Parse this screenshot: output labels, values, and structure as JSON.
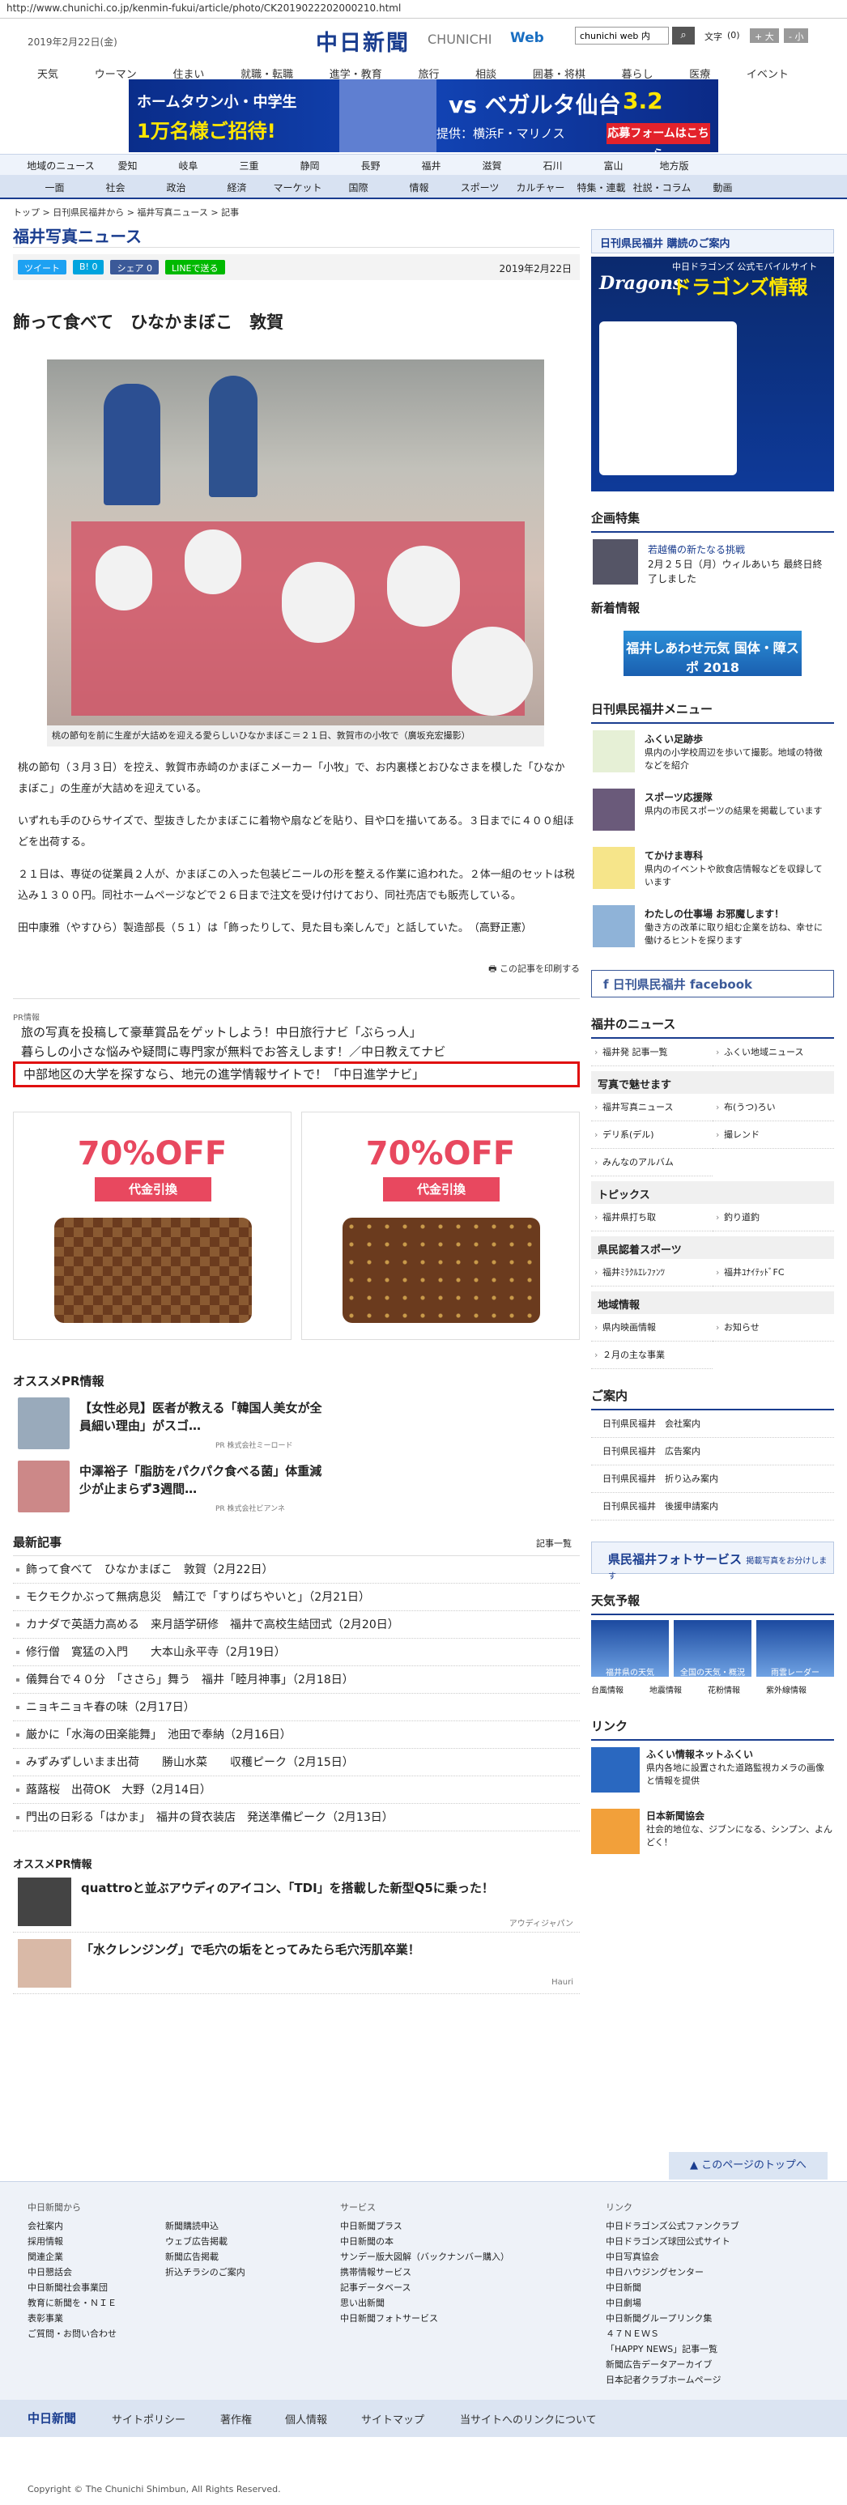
{
  "url": "http://www.chunichi.co.jp/kenmin-fukui/article/photo/CK2019022202000210.html",
  "header": {
    "date": "2019年2月22日(金)",
    "logo": "中日新聞",
    "logo_sub": "CHUNICHI",
    "logo_web": "Web",
    "search_value": "chunichi web 内",
    "text_size_label": "文字",
    "text_size_value": "(0)",
    "size_up": "+ 大",
    "size_down": "- 小"
  },
  "gnav": [
    "天気",
    "ウーマン",
    "住まい",
    "就職・転職",
    "進学・教育",
    "旅行",
    "相談",
    "囲碁・将棋",
    "暮らし",
    "医療",
    "イベント"
  ],
  "banner": {
    "line1": "ホームタウン小・中学生",
    "line2": "1万名様ご招待!",
    "vs": "vs ベガルタ仙台",
    "date": "3.2",
    "sub": "提供：横浜F・マリノス",
    "cta": "応募フォームはこちら"
  },
  "region_nav": [
    "地域のニュース",
    "愛知",
    "岐阜",
    "三重",
    "静岡",
    "長野",
    "福井",
    "滋賀",
    "石川",
    "富山",
    "地方版"
  ],
  "cat_nav": [
    "一面",
    "社会",
    "政治",
    "経済",
    "マーケット",
    "国際",
    "情報",
    "スポーツ",
    "カルチャー",
    "特集・連載",
    "社説・コラム",
    "動画"
  ],
  "breadcrumb": "トップ > 日刊県民福井から > 福井写真ニュース > 記事",
  "section_title": "福井写真ニュース",
  "share": {
    "tweet": "ツイート",
    "hatena": "B! 0",
    "facebook": "シェア 0",
    "line": "LINEで送る",
    "date": "2019年2月22日"
  },
  "headline": "飾って食べて　ひなかまぼこ　敦賀",
  "caption": "桃の節句を前に生産が大詰めを迎える愛らしいひなかまぼこ＝２１日、敦賀市の小牧で（廣坂充宏撮影）",
  "body": [
    "桃の節句（３月３日）を控え、敦賀市赤崎のかまぼこメーカー「小牧」で、お内裏様とおひなさまを模した「ひなかまぼこ」の生産が大詰めを迎えている。",
    "いずれも手のひらサイズで、型抜きしたかまぼこに着物や扇などを貼り、目や口を描いてある。３日までに４００組ほどを出荷する。",
    "２１日は、専従の従業員２人が、かまぼこの入った包装ビニールの形を整える作業に追われた。２体一組のセットは税込み１３００円。同社ホームページなどで２６日まで注文を受け付けており、同社売店でも販売している。",
    "田中康雅（やすひら）製造部長（５１）は「飾ったりして、見た目も楽しんで」と話していた。　（高野正憲）"
  ],
  "print_label": "この記事を印刷する",
  "pr": {
    "label": "PR情報",
    "items": [
      "旅の写真を投稿して豪華賞品をゲットしよう！中日旅行ナビ「ぶらっ人」",
      "暮らしの小さな悩みや疑問に専門家が無料でお答えします！／中日教えてナビ",
      "中部地区の大学を探すなら、地元の進学情報サイトで！「中日進学ナビ」"
    ]
  },
  "ads": [
    {
      "off": "70%OFF",
      "sub": "代金引換"
    },
    {
      "off": "70%OFF",
      "sub": "代金引換"
    }
  ],
  "osusume": {
    "title": "オススメPR情報",
    "items": [
      {
        "t": "【女性必見】医者が教える「韓国人美女が全員細い理由」がスゴ…",
        "pr": "PR 株式会社ミーロード"
      },
      {
        "t": "中澤裕子「脂肪をパクパク食べる菌」体重減少が止まらず3週間…",
        "pr": "PR 株式会社ビアンネ"
      }
    ]
  },
  "latest": {
    "title": "最新記事",
    "more": "記事一覧",
    "items": [
      "飾って食べて　ひなかまぼこ　敦賀（2月22日）",
      "モクモクかぶって無病息災　鯖江で「すりばちやいと」（2月21日）",
      "カナダで英語力高める　来月語学研修　福井で高校生結団式（2月20日）",
      "修行僧　寛猛の入門　　大本山永平寺（2月19日）",
      "儀舞台で４０分　「ささら」舞う　福井「睦月神事」（2月18日）",
      "ニョキニョキ春の味（2月17日）",
      "厳かに「水海の田楽能舞」　池田で奉納（2月16日）",
      "みずみずしいまま出荷　　勝山水菜　　収穫ピーク（2月15日）",
      "蕗蕗桜　出荷OK　大野（2月14日）",
      "門出の日彩る「はかま」　福井の貸衣装店　発送準備ピーク（2月13日）"
    ]
  },
  "osusume2": {
    "title": "オススメPR情報",
    "items": [
      {
        "t": "quattroと並ぶアウディのアイコン、「TDI」を搭載した新型Q5に乗った！",
        "pr": "アウディジャパン"
      },
      {
        "t": "「水クレンジング」で毛穴の垢をとってみたら毛穴汚肌卒業！",
        "pr": "Hauri"
      }
    ]
  },
  "side": {
    "subscribe": "日刊県民福井 購読のご案内",
    "dragons_logo": "Dragons",
    "dragons_title": "ドラゴンズ情報",
    "dragons_sub": "中日ドラゴンズ 公式モバイルサイト",
    "kikaku": {
      "title": "企画特集",
      "t1": "若越備の新たなる挑戦",
      "t2": "2月２５日（月）ウィルあいち 最終日終了しました"
    },
    "shinchaku": "新着情報",
    "fukui_btn": "福井しあわせ元気 国体・障スポ 2018",
    "menu_title": "日刊県民福井メニュー",
    "menu": [
      {
        "t1": "ふくい足跡歩",
        "t2": "県内の小学校周辺を歩いて撮影。地域の特徴などを紹介"
      },
      {
        "t1": "スポーツ応援隊",
        "t2": "県内の市民スポーツの結果を掲載しています"
      },
      {
        "t1": "てかけま専科",
        "t2": "県内のイベントや飲食店情報などを収録しています"
      },
      {
        "t1": "わたしの仕事場 お邪魔します！",
        "t2": "働き方の改革に取り組む企業を訪ね、幸せに働けるヒントを探ります"
      }
    ],
    "facebook": "日刊県民福井 facebook",
    "news_title": "福井のニュース",
    "news": [
      "福井発 記事一覧",
      "ふくい地域ニュース"
    ],
    "photo_h": "写真で魅せます",
    "photo": [
      "福井写真ニュース",
      "布(うつ)ろい",
      "デリ系(デル)",
      "撮レンド",
      "みんなのアルバム"
    ],
    "topics_h": "トピックス",
    "topics": [
      "福井県打ち取",
      "釣り道釣"
    ],
    "sports_h": "県民認着スポーツ",
    "sports": [
      "福井ﾐﾗｸﾙｴﾚﾌｧﾝﾂ",
      "福井ﾕﾅｲﾃｯﾄﾞFC"
    ],
    "local_h": "地域情報",
    "local": [
      "県内映画情報",
      "お知らせ",
      "２月の主な事業"
    ],
    "guide_h": "ご案内",
    "guide": [
      "日刊県民福井　会社案内",
      "日刊県民福井　広告案内",
      "日刊県民福井　折り込み案内",
      "日刊県民福井　後援申請案内"
    ],
    "photo_svc": "県民福井フォトサービス",
    "photo_svc_sub": "掲載写真をお分けします",
    "weather_h": "天気予報",
    "weather": [
      "福井県の天気",
      "全国の天気・概況",
      "雨雲レーダー"
    ],
    "weather_links": [
      "台風情報",
      "地震情報",
      "花粉情報",
      "紫外線情報"
    ],
    "link_h": "リンク",
    "links": [
      {
        "t1": "ふくい情報ネットふくい",
        "t2": "県内各地に設置された道路監視カメラの画像と情報を提供"
      },
      {
        "t1": "日本新聞協会",
        "t2": "社会的地位な、ジブンになる、シンプン、よんどく！"
      }
    ]
  },
  "pagetop": "このページのトップへ",
  "footer": {
    "c1_h": "中日新聞から",
    "c1": [
      "会社案内",
      "採用情報",
      "関連企業",
      "中日懇話会",
      "中日新聞社会事業団",
      "教育に新聞を・ＮＩＥ",
      "表彰事業",
      "ご質問・お問い合わせ"
    ],
    "c2": [
      "新聞購読申込",
      "ウェブ広告掲載",
      "新聞広告掲載",
      "折込チラシのご案内"
    ],
    "c3_h": "サービス",
    "c3": [
      "中日新聞プラス",
      "中日新聞の本",
      "サンデー版大図解（バックナンバー購入）",
      "携帯情報サービス",
      "記事データベース",
      "思い出新聞",
      "中日新聞フォトサービス"
    ],
    "c4_h": "リンク",
    "c4": [
      "中日ドラゴンズ公式ファンクラブ",
      "中日ドラゴンズ球団公式サイト",
      "中日写真協会",
      "中日ハウジングセンター",
      "中日新聞",
      "中日劇場",
      "中日新聞グループリンク集",
      "４７ＮＥＷＳ",
      "「HAPPY NEWS」記事一覧",
      "新聞広告データアーカイブ",
      "日本記者クラブホームページ"
    ]
  },
  "fbar": [
    "中日新聞",
    "サイトポリシー",
    "著作権",
    "個人情報",
    "サイトマップ",
    "当サイトへのリンクについて"
  ],
  "copyright": "Copyright © The Chunichi Shimbun, All Rights Reserved."
}
